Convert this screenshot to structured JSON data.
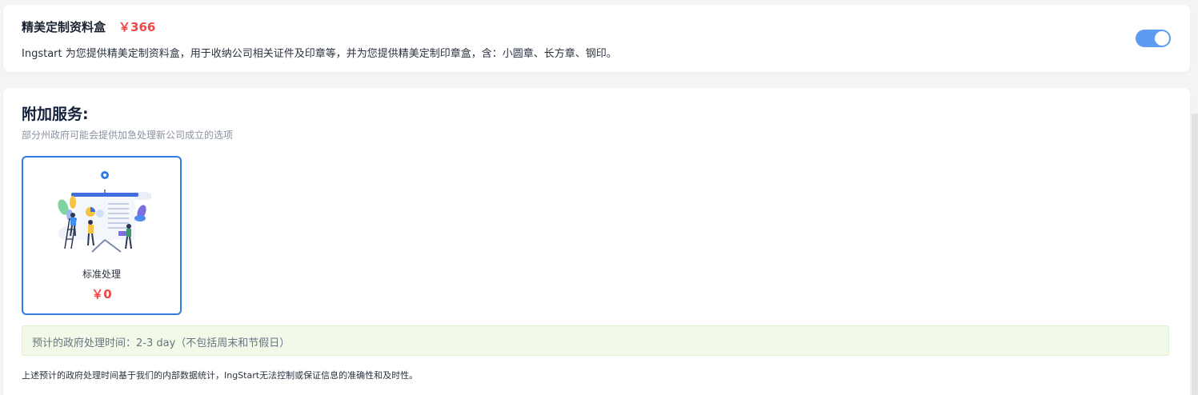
{
  "top_card": {
    "title": "精美定制资料盒",
    "price": "￥366",
    "description": "Ingstart 为您提供精美定制资料盒，用于收纳公司相关证件及印章等，并为您提供精美定制印章盒，含：小圆章、长方章、钢印。",
    "toggle_on": true
  },
  "services": {
    "title": "附加服务:",
    "subtitle": "部分州政府可能会提供加急处理新公司成立的选项",
    "options": [
      {
        "label": "标准处理",
        "price": "￥0",
        "selected": true,
        "icon": "presentation-team-illustration"
      }
    ],
    "notice": "预计的政府处理时间：2-3 day（不包括周末和节假日）",
    "footnote": "上述预计的政府处理时间基于我们的内部数据统计，IngStart无法控制或保证信息的准确性和及时性。"
  },
  "colors": {
    "accent": "#2f7de1",
    "price": "#f04848",
    "toggle": "#5b9bf0",
    "notice_bg": "#f1fae9"
  }
}
